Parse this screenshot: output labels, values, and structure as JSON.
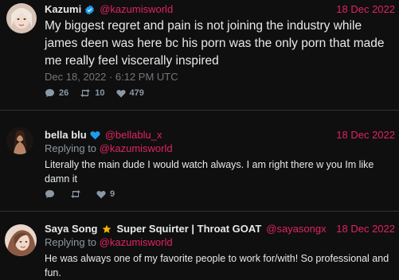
{
  "tweets": [
    {
      "display_name": "Kazumi",
      "handle": "@kazumisworld",
      "date": "18 Dec 2022",
      "text": "My biggest regret and pain is not joining the industry while james deen was here bc his porn was the only porn that made me really feel viscerally inspired",
      "timestamp": "Dec 18, 2022 · 6:12 PM UTC",
      "stats": {
        "replies": "26",
        "retweets": "10",
        "likes": "479"
      },
      "badge_icon": "verified-badge-icon",
      "badge_color": "#1d9bf0"
    },
    {
      "display_name": "bella blu",
      "handle": "@bellablu_x",
      "date": "18 Dec 2022",
      "replying_prefix": "Replying to",
      "replying_to": "@kazumisworld",
      "text": "Literally the main dude I would watch always. I am right there w you Im like damn it",
      "stats": {
        "replies": "",
        "retweets": "",
        "likes": "9"
      },
      "badge_icon": "blue-heart-icon",
      "badge_color": "#1d9bf0"
    },
    {
      "display_name": "Saya Song",
      "name_suffix": "Super Squirter | Throat GOAT",
      "handle": "@sayasongx",
      "date": "18 Dec 2022",
      "replying_prefix": "Replying to",
      "replying_to": "@kazumisworld",
      "text": "He was always one of my favorite people to work for/with! So professional and fun.",
      "badge_icon": "star-icon",
      "badge_color": "#f4b400"
    }
  ],
  "colors": {
    "background": "#0f0f0f",
    "accent": "#e0245e",
    "text": "#e7e9ea",
    "muted": "#8b98a5",
    "divider": "#2f3336"
  }
}
